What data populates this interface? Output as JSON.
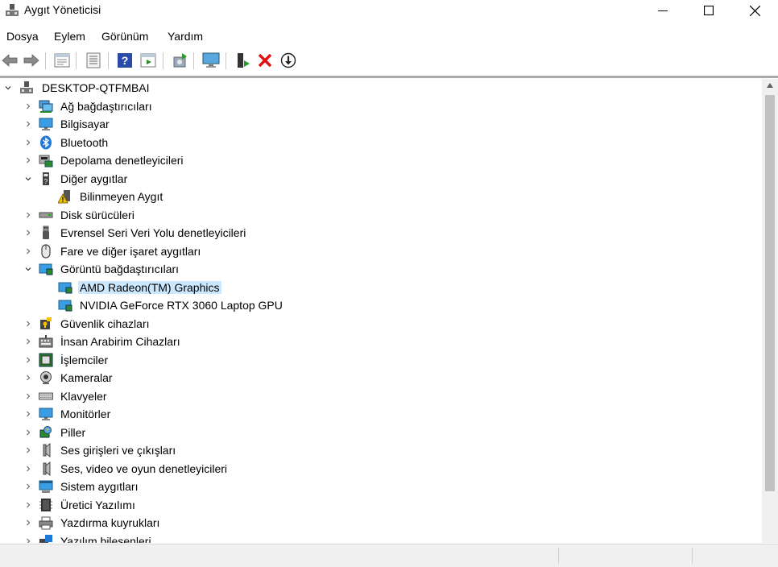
{
  "window": {
    "title": "Aygıt Yöneticisi"
  },
  "menu": [
    "Dosya",
    "Eylem",
    "Görünüm",
    "Yardım"
  ],
  "toolbar": [
    "back-icon",
    "forward-icon",
    "properties-icon",
    "device-list-icon",
    "help-icon",
    "show-hidden-icon",
    "update-driver-icon",
    "scan-hardware-icon",
    "enable-device-icon",
    "uninstall-icon",
    "disable-device-icon"
  ],
  "tree": {
    "root": "DESKTOP-QTFMBAI",
    "rows": [
      {
        "label": "Ağ bağdaştırıcıları",
        "icon": "network-adapter-icon",
        "expanded": false,
        "level": 1
      },
      {
        "label": "Bilgisayar",
        "icon": "computer-icon",
        "expanded": false,
        "level": 1
      },
      {
        "label": "Bluetooth",
        "icon": "bluetooth-icon",
        "expanded": false,
        "level": 1
      },
      {
        "label": "Depolama denetleyicileri",
        "icon": "storage-controller-icon",
        "expanded": false,
        "level": 1
      },
      {
        "label": "Diğer aygıtlar",
        "icon": "other-devices-icon",
        "expanded": true,
        "level": 1
      },
      {
        "label": "Bilinmeyen Aygıt",
        "icon": "unknown-device-warning-icon",
        "level": 2
      },
      {
        "label": "Disk sürücüleri",
        "icon": "disk-drive-icon",
        "expanded": false,
        "level": 1
      },
      {
        "label": "Evrensel Seri Veri Yolu denetleyicileri",
        "icon": "usb-controller-icon",
        "expanded": false,
        "level": 1
      },
      {
        "label": "Fare ve diğer işaret aygıtları",
        "icon": "mouse-icon",
        "expanded": false,
        "level": 1
      },
      {
        "label": "Görüntü bağdaştırıcıları",
        "icon": "display-adapter-icon",
        "expanded": true,
        "level": 1
      },
      {
        "label": "AMD Radeon(TM) Graphics",
        "icon": "display-adapter-icon",
        "level": 2,
        "selected": true
      },
      {
        "label": "NVIDIA GeForce RTX 3060 Laptop GPU",
        "icon": "display-adapter-icon",
        "level": 2
      },
      {
        "label": "Güvenlik cihazları",
        "icon": "security-device-icon",
        "expanded": false,
        "level": 1
      },
      {
        "label": "İnsan Arabirim Cihazları",
        "icon": "hid-icon",
        "expanded": false,
        "level": 1
      },
      {
        "label": "İşlemciler",
        "icon": "processor-icon",
        "expanded": false,
        "level": 1
      },
      {
        "label": "Kameralar",
        "icon": "camera-icon",
        "expanded": false,
        "level": 1
      },
      {
        "label": "Klavyeler",
        "icon": "keyboard-icon",
        "expanded": false,
        "level": 1
      },
      {
        "label": "Monitörler",
        "icon": "monitor-icon",
        "expanded": false,
        "level": 1
      },
      {
        "label": "Piller",
        "icon": "battery-icon",
        "expanded": false,
        "level": 1
      },
      {
        "label": "Ses girişleri ve çıkışları",
        "icon": "audio-io-icon",
        "expanded": false,
        "level": 1
      },
      {
        "label": "Ses, video ve oyun denetleyicileri",
        "icon": "sound-video-icon",
        "expanded": false,
        "level": 1
      },
      {
        "label": "Sistem aygıtları",
        "icon": "system-device-icon",
        "expanded": false,
        "level": 1
      },
      {
        "label": "Üretici Yazılımı",
        "icon": "firmware-icon",
        "expanded": false,
        "level": 1
      },
      {
        "label": "Yazdırma kuyrukları",
        "icon": "print-queue-icon",
        "expanded": false,
        "level": 1
      },
      {
        "label": "Yazılım bileşenleri",
        "icon": "software-component-icon",
        "expanded": false,
        "level": 1
      }
    ]
  },
  "colors": {
    "selection": "#cce8ff",
    "accent_blue": "#1e78d7",
    "uninstall_red": "#e01010"
  }
}
